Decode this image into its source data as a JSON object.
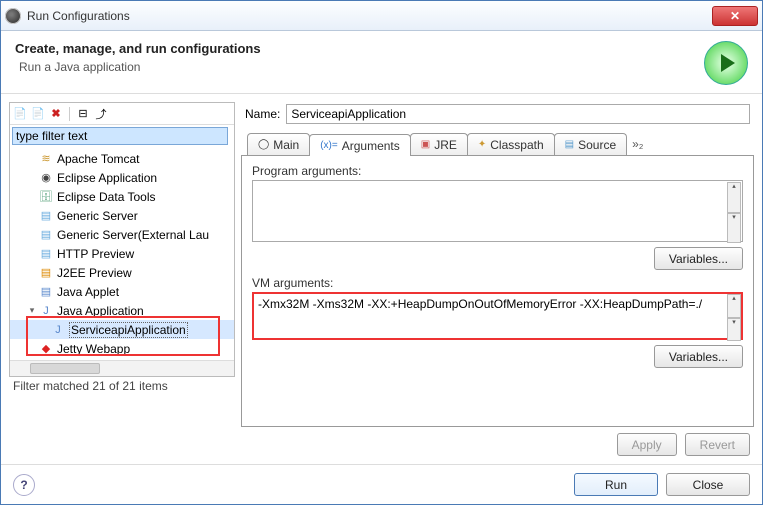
{
  "window": {
    "title": "Run Configurations"
  },
  "header": {
    "title": "Create, manage, and run configurations",
    "subtitle": "Run a Java application"
  },
  "toolbar_icons": {
    "new": "📄",
    "copy": "📄",
    "delete": "✖",
    "expand": "⊟",
    "collapse": "⤴"
  },
  "filter": {
    "placeholder": "type filter text",
    "status": "Filter matched 21 of 21 items"
  },
  "tree": [
    {
      "label": "Apache Tomcat",
      "icon": "≋",
      "cls": "ico-tomcat"
    },
    {
      "label": "Eclipse Application",
      "icon": "◉",
      "cls": "ico-eclipse"
    },
    {
      "label": "Eclipse Data Tools",
      "icon": "🗄",
      "cls": "ico-db"
    },
    {
      "label": "Generic Server",
      "icon": "▤",
      "cls": "ico-srv"
    },
    {
      "label": "Generic Server(External Lau",
      "icon": "▤",
      "cls": "ico-srv"
    },
    {
      "label": "HTTP Preview",
      "icon": "▤",
      "cls": "ico-srv"
    },
    {
      "label": "J2EE Preview",
      "icon": "▤",
      "cls": "ico-j2ee"
    },
    {
      "label": "Java Applet",
      "icon": "▤",
      "cls": "ico-java"
    }
  ],
  "java_app": {
    "label": "Java Application",
    "child": "ServiceapiApplication"
  },
  "jetty": {
    "label": "Jetty Webapp"
  },
  "name": {
    "label": "Name:",
    "value": "ServiceapiApplication"
  },
  "tabs": {
    "main": "Main",
    "arguments": "Arguments",
    "jre": "JRE",
    "classpath": "Classpath",
    "source": "Source",
    "more": "»₂"
  },
  "panel": {
    "program_label": "Program arguments:",
    "program_value": "",
    "vm_label": "VM arguments:",
    "vm_value": "-Xmx32M -Xms32M -XX:+HeapDumpOnOutOfMemoryError -XX:HeapDumpPath=./",
    "variables": "Variables..."
  },
  "buttons": {
    "apply": "Apply",
    "revert": "Revert",
    "run": "Run",
    "close": "Close"
  }
}
